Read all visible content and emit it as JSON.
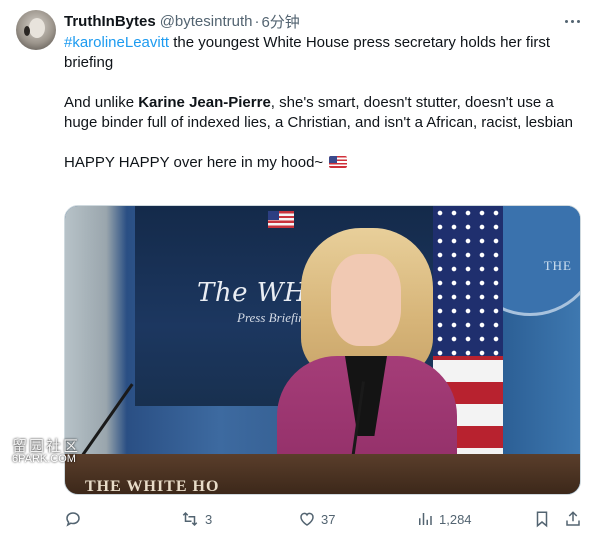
{
  "author": {
    "display_name": "TruthInBytes",
    "handle": "@bytesintruth",
    "separator": "·",
    "time": "6分钟"
  },
  "tweet": {
    "hashtag": "#karolineLeavitt",
    "line1_rest": " the youngest White House press secretary holds her first briefing",
    "para2_before": "And unlike ",
    "para2_bold": "Karine Jean-Pierre",
    "para2_after": ", she's smart, doesn't stutter, doesn't use a huge binder full of indexed lies, a Christian, and isn't a African, racist, lesbian",
    "para3": "HAPPY HAPPY over here in my hood~"
  },
  "media": {
    "backdrop_logo": "The WHITE HO",
    "backdrop_sub": "Press Briefing",
    "seal_text": "THE",
    "podium_text": "THE WHITE HO",
    "watermark_cn": "留园社区",
    "watermark_site": "6PARK.COM"
  },
  "actions": {
    "reply_count": "",
    "retweet_count": "3",
    "like_count": "37",
    "views_count": "1,284"
  },
  "icons": {
    "more": "more-horizontal-icon",
    "reply": "reply-icon",
    "retweet": "retweet-icon",
    "like": "heart-icon",
    "views": "views-chart-icon",
    "bookmark": "bookmark-icon",
    "share": "share-icon",
    "flag": "us-flag-emoji-icon"
  },
  "colors": {
    "link": "#1d9bf0",
    "secondary_text": "#536471",
    "primary_text": "#0f1419"
  }
}
